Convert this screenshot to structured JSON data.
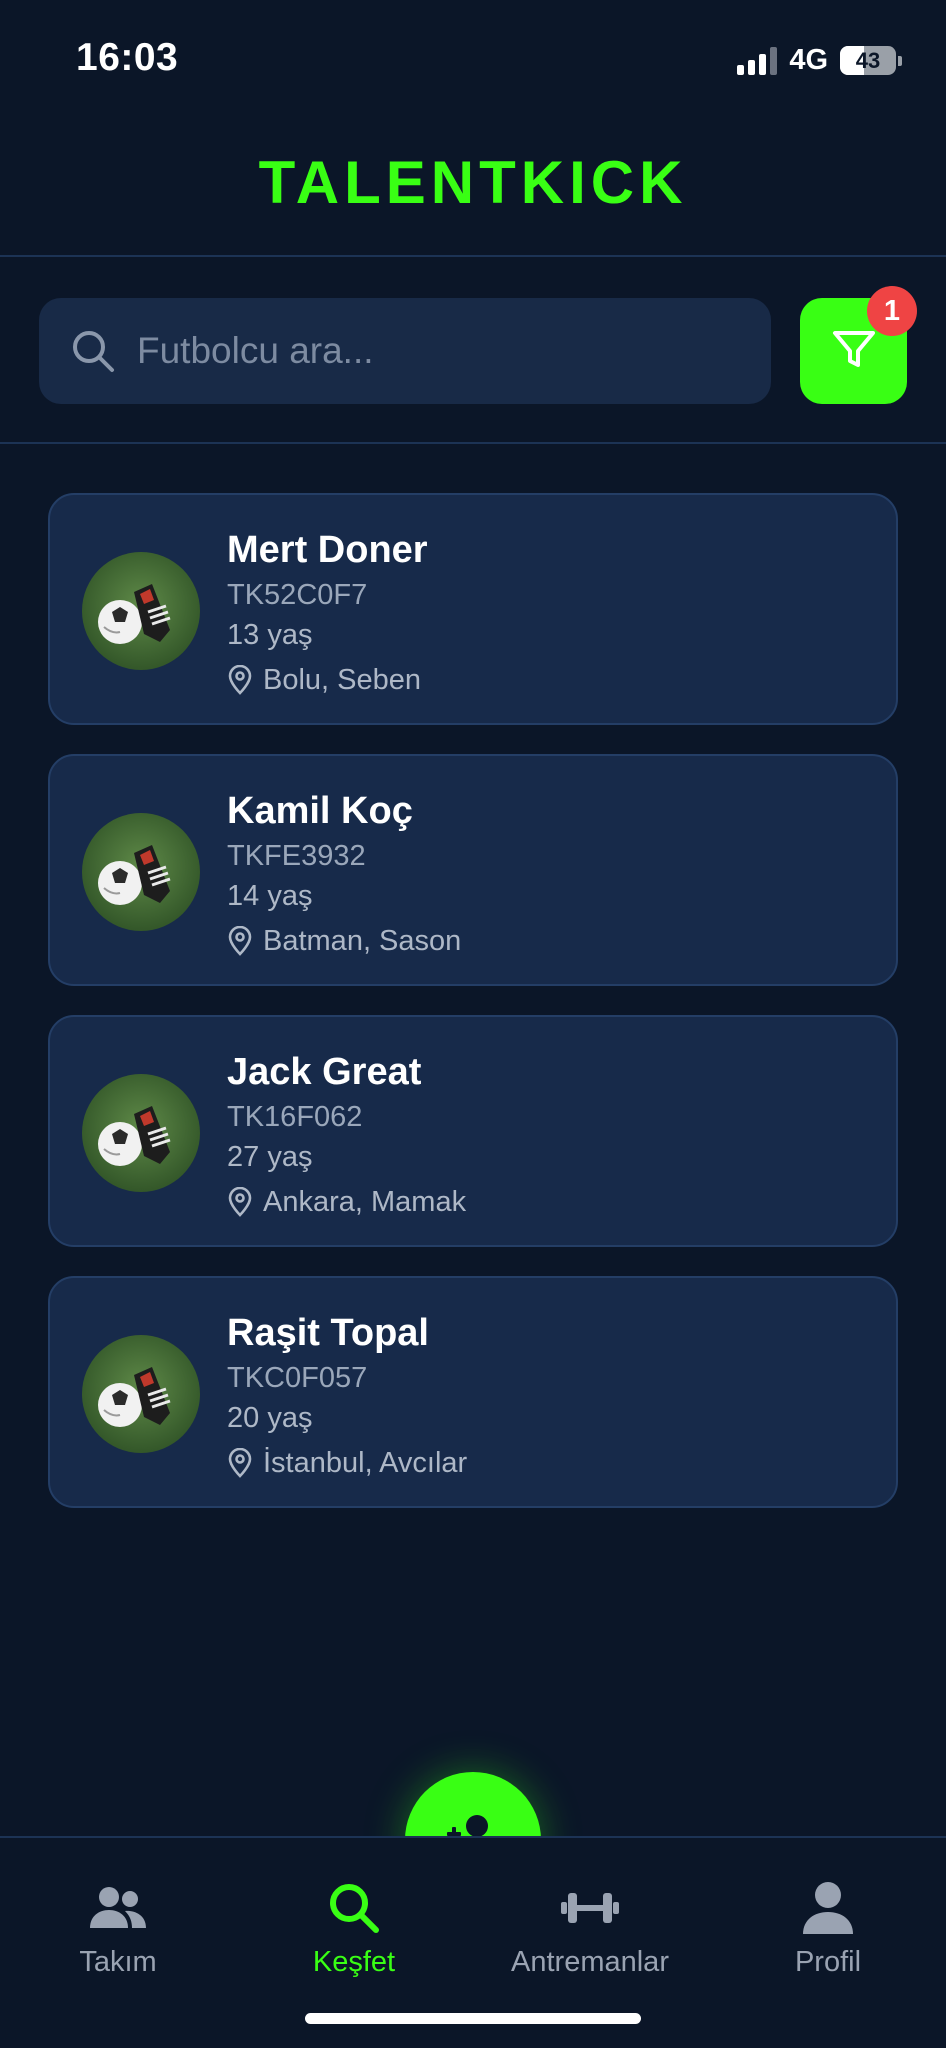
{
  "status_bar": {
    "time": "16:03",
    "network": "4G",
    "battery": "43",
    "battery_level_percent": 43
  },
  "header": {
    "title": "TALENTKICK"
  },
  "search": {
    "placeholder": "Futbolcu ara...",
    "value": "",
    "icon": "search-icon",
    "filter_icon": "filter-icon",
    "filter_badge": "1"
  },
  "colors": {
    "background": "#0b1628",
    "card": "#172a4a",
    "accent": "#39ff14",
    "badge": "#ef4444"
  },
  "players": [
    {
      "name": "Mert Doner",
      "code": "TK52C0F7",
      "age": "13 yaş",
      "location": "Bolu, Seben"
    },
    {
      "name": "Kamil Koç",
      "code": "TKFE3932",
      "age": "14 yaş",
      "location": "Batman, Sason"
    },
    {
      "name": "Jack Great",
      "code": "TK16F062",
      "age": "27 yaş",
      "location": "Ankara, Mamak"
    },
    {
      "name": "Raşit Topal",
      "code": "TKC0F057",
      "age": "20 yaş",
      "location": "İstanbul, Avcılar"
    }
  ],
  "nav": {
    "items": [
      {
        "label": "Takım",
        "icon": "team-icon"
      },
      {
        "label": "Keşfet",
        "icon": "search-icon",
        "active": true
      },
      {
        "label": "Antremanlar",
        "icon": "dumbbell-icon"
      },
      {
        "label": "Profil",
        "icon": "profile-icon"
      }
    ],
    "fab_icon": "add-user-icon"
  }
}
